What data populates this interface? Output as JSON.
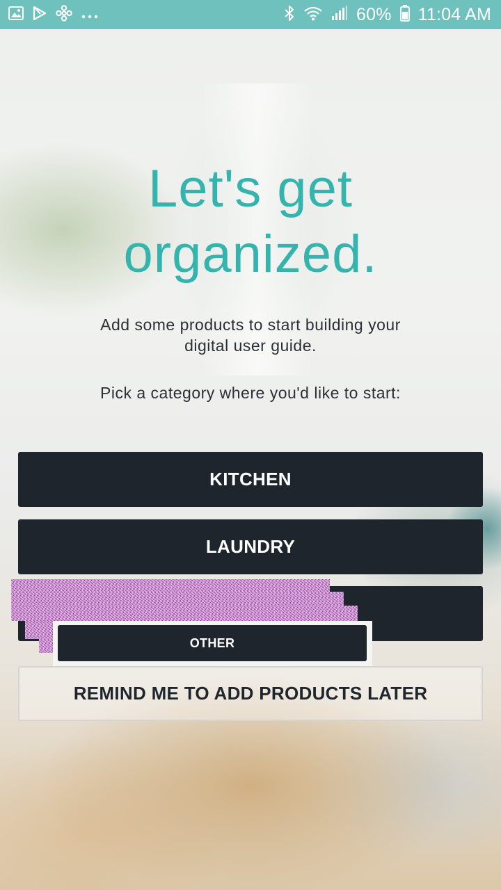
{
  "status_bar": {
    "left_icons": [
      "gallery-icon",
      "play-store-icon",
      "fan-icon",
      "more-dots-icon"
    ],
    "right_icons": [
      "bluetooth-icon",
      "wifi-icon",
      "signal-icon",
      "battery-icon"
    ],
    "battery": "60%",
    "time": "11:04 AM",
    "color": "#6fc1bd"
  },
  "main": {
    "headline": "Let's get organized.",
    "subtitle": "Add some products to start building your digital user guide.",
    "prompt": "Pick a category where you'd like to start:"
  },
  "buttons": {
    "kitchen": "KITCHEN",
    "laundry": "LAUNDRY",
    "other": "OTHER",
    "remind_later": "REMIND ME TO ADD PRODUCTS LATER"
  },
  "colors": {
    "accent": "#35b3ad",
    "button_dark": "#1f252d",
    "text_dark": "#2b2f36"
  }
}
